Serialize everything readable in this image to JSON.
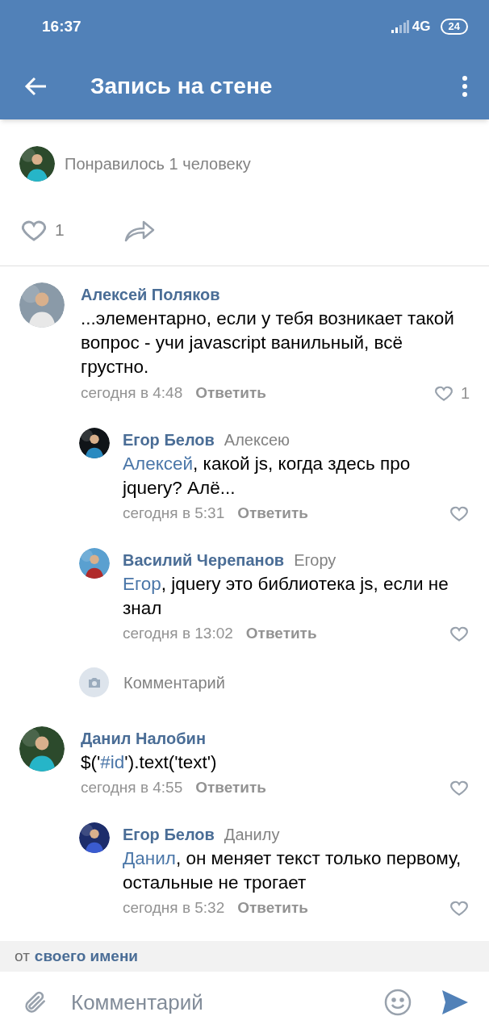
{
  "status_bar": {
    "time": "16:37",
    "network": "4G",
    "battery": "24"
  },
  "app_bar": {
    "title": "Запись на стене"
  },
  "likes_summary": {
    "text": "Понравилось 1 человеку"
  },
  "post_actions": {
    "like_count": "1"
  },
  "comments": [
    {
      "author": "Алексей Поляков",
      "body": [
        {
          "text": "...элементарно, если у тебя возникает такой вопрос - учи javascript ванильный, всё грустно.",
          "link": false
        }
      ],
      "time": "сегодня в 4:48",
      "reply": "Ответить",
      "likes": "1",
      "children": [
        {
          "author": "Егор Белов",
          "reply_to": "Алексею",
          "body": [
            {
              "text": "Алексей",
              "link": true
            },
            {
              "text": ", какой js, когда здесь про jquery? Алё...",
              "link": false
            }
          ],
          "time": "сегодня в 5:31",
          "reply": "Ответить"
        },
        {
          "author": "Василий Черепанов",
          "reply_to": "Егору",
          "body": [
            {
              "text": "Егор",
              "link": true
            },
            {
              "text": ", jquery  это библиотека js, если не знал",
              "link": false
            }
          ],
          "time": "сегодня в 13:02",
          "reply": "Ответить"
        }
      ],
      "comment_prompt": "Комментарий"
    },
    {
      "author": "Данил Налобин",
      "body": [
        {
          "text": "$('",
          "link": false
        },
        {
          "text": "#id",
          "link": true
        },
        {
          "text": "').text('text')",
          "link": false
        }
      ],
      "time": "сегодня в 4:55",
      "reply": "Ответить",
      "children": [
        {
          "author": "Егор Белов",
          "reply_to": "Данилу",
          "body": [
            {
              "text": "Данил",
              "link": true
            },
            {
              "text": ", он меняет текст только первому, остальные не трогает",
              "link": false
            }
          ],
          "time": "сегодня в 5:32",
          "reply": "Ответить"
        }
      ]
    }
  ],
  "sender_bar": {
    "prefix": "от",
    "identity": "своего имени"
  },
  "composer": {
    "placeholder": "Комментарий"
  }
}
